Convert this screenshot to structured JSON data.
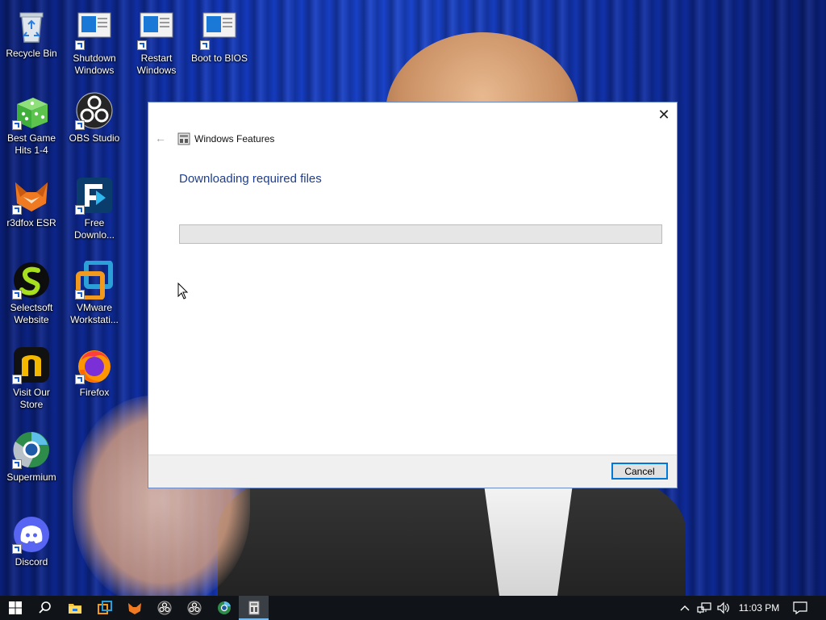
{
  "desktop": {
    "icons": [
      {
        "label": "Recycle Bin"
      },
      {
        "label": "Shutdown\nWindows"
      },
      {
        "label": "Restart\nWindows"
      },
      {
        "label": "Boot to BIOS"
      },
      {
        "label": "Best Game\nHits 1-4"
      },
      {
        "label": "OBS Studio"
      },
      {
        "label": "r3dfox ESR"
      },
      {
        "label": "Free\nDownlo..."
      },
      {
        "label": "Selectsoft\nWebsite"
      },
      {
        "label": "VMware\nWorkstati..."
      },
      {
        "label": "Visit Our\nStore"
      },
      {
        "label": "Firefox"
      },
      {
        "label": "Supermium"
      },
      {
        "label": "Discord"
      }
    ]
  },
  "dialog": {
    "title": "Windows Features",
    "heading": "Downloading required files",
    "progress": 0,
    "cancel_label": "Cancel",
    "close_glyph": "✕",
    "back_glyph": "←"
  },
  "taskbar": {
    "items": [
      "windows-start",
      "search",
      "file-explorer",
      "task-view",
      "r3dfox",
      "obs-studio",
      "obs-studio",
      "supermium",
      "windows-features"
    ],
    "clock": "11:03 PM",
    "accent": "#76b9ed"
  },
  "colors": {
    "dialog_heading": "#1f3d8a",
    "button_focus": "#0078d7",
    "progress_fill": "#06b025"
  }
}
